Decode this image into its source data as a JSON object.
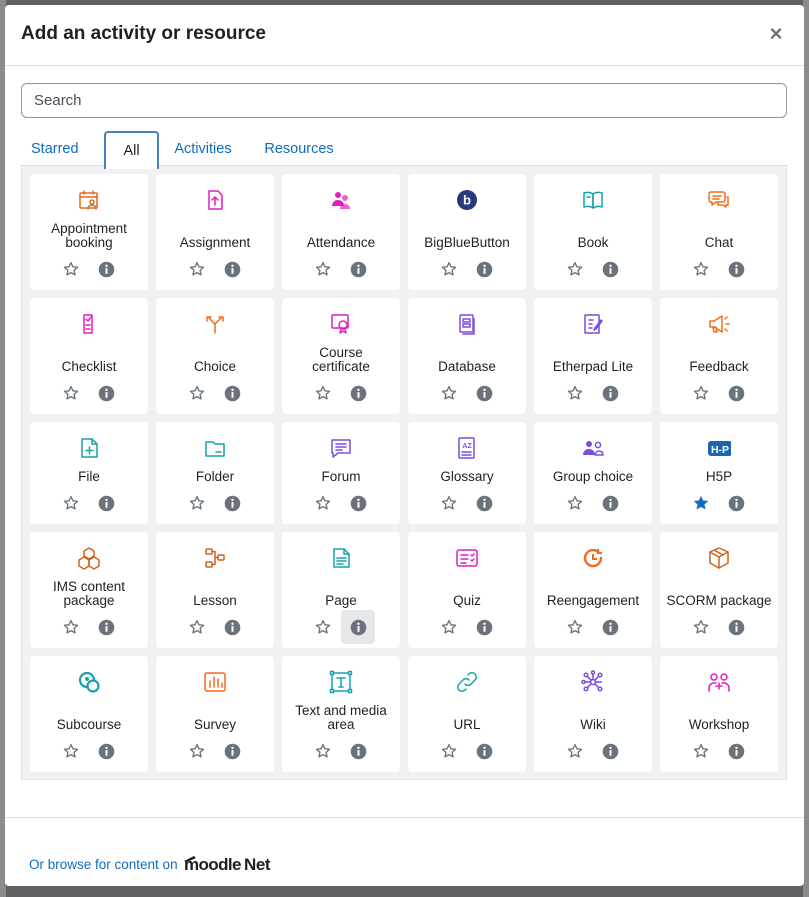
{
  "modal": {
    "title": "Add an activity or resource",
    "close_label": "×"
  },
  "search": {
    "placeholder": "Search",
    "value": ""
  },
  "tabs": [
    {
      "label": "Starred",
      "active": false
    },
    {
      "label": "All",
      "active": true
    },
    {
      "label": "Activities",
      "active": false
    },
    {
      "label": "Resources",
      "active": false
    }
  ],
  "items": [
    {
      "name": "Appointment booking",
      "lines": [
        "Appointment",
        "booking"
      ],
      "icon": "appointment-calendar-icon",
      "color": "#e06c1a",
      "starred": false
    },
    {
      "name": "Assignment",
      "lines": [
        "Assignment"
      ],
      "icon": "assignment-upload-icon",
      "color": "#e31ec0",
      "starred": false
    },
    {
      "name": "Attendance",
      "lines": [
        "Attendance"
      ],
      "icon": "attendance-people-icon",
      "color": "#e31ec0",
      "starred": false
    },
    {
      "name": "BigBlueButton",
      "lines": [
        "BigBlueButton"
      ],
      "icon": "bigbluebutton-icon",
      "color": "#273a7c",
      "starred": false
    },
    {
      "name": "Book",
      "lines": [
        "Book"
      ],
      "icon": "book-icon",
      "color": "#14a3a9",
      "starred": false
    },
    {
      "name": "Chat",
      "lines": [
        "Chat"
      ],
      "icon": "chat-icon",
      "color": "#f26b1d",
      "starred": false
    },
    {
      "name": "Checklist",
      "lines": [
        "Checklist"
      ],
      "icon": "checklist-icon",
      "color": "#e31ec0",
      "starred": false
    },
    {
      "name": "Choice",
      "lines": [
        "Choice"
      ],
      "icon": "choice-arrows-icon",
      "color": "#f26b1d",
      "starred": false
    },
    {
      "name": "Course certificate",
      "lines": [
        "Course",
        "certificate"
      ],
      "icon": "certificate-icon",
      "color": "#e31ec0",
      "starred": false
    },
    {
      "name": "Database",
      "lines": [
        "Database"
      ],
      "icon": "database-icon",
      "color": "#7a4fe0",
      "starred": false
    },
    {
      "name": "Etherpad Lite",
      "lines": [
        "Etherpad Lite"
      ],
      "icon": "etherpad-icon",
      "color": "#7a4fe0",
      "starred": false
    },
    {
      "name": "Feedback",
      "lines": [
        "Feedback"
      ],
      "icon": "feedback-megaphone-icon",
      "color": "#f26b1d",
      "starred": false
    },
    {
      "name": "File",
      "lines": [
        "File"
      ],
      "icon": "file-icon",
      "color": "#14a3a9",
      "starred": false
    },
    {
      "name": "Folder",
      "lines": [
        "Folder"
      ],
      "icon": "folder-icon",
      "color": "#14a3a9",
      "starred": false
    },
    {
      "name": "Forum",
      "lines": [
        "Forum"
      ],
      "icon": "forum-icon",
      "color": "#7a4fe0",
      "starred": false
    },
    {
      "name": "Glossary",
      "lines": [
        "Glossary"
      ],
      "icon": "glossary-icon",
      "color": "#7a4fe0",
      "starred": false
    },
    {
      "name": "Group choice",
      "lines": [
        "Group choice"
      ],
      "icon": "group-choice-icon",
      "color": "#7a4fe0",
      "starred": false
    },
    {
      "name": "H5P",
      "lines": [
        "H5P"
      ],
      "icon": "h5p-icon",
      "color": "#1b65b4",
      "starred": true
    },
    {
      "name": "IMS content package",
      "lines": [
        "IMS content",
        "package"
      ],
      "icon": "ims-package-icon",
      "color": "#d1621b",
      "starred": false
    },
    {
      "name": "Lesson",
      "lines": [
        "Lesson"
      ],
      "icon": "lesson-flow-icon",
      "color": "#d1621b",
      "starred": false
    },
    {
      "name": "Page",
      "lines": [
        "Page"
      ],
      "icon": "page-icon",
      "color": "#14a3a9",
      "starred": false
    },
    {
      "name": "Quiz",
      "lines": [
        "Quiz"
      ],
      "icon": "quiz-icon",
      "color": "#e31ec0",
      "starred": false
    },
    {
      "name": "Reengagement",
      "lines": [
        "Reengagement"
      ],
      "icon": "reengagement-icon",
      "color": "#f26b1d",
      "starred": false
    },
    {
      "name": "SCORM package",
      "lines": [
        "SCORM package"
      ],
      "icon": "scorm-box-icon",
      "color": "#d1621b",
      "starred": false
    },
    {
      "name": "Subcourse",
      "lines": [
        "Subcourse"
      ],
      "icon": "subcourse-icon",
      "color": "#14a3a9",
      "starred": false
    },
    {
      "name": "Survey",
      "lines": [
        "Survey"
      ],
      "icon": "survey-chart-icon",
      "color": "#f26b1d",
      "starred": false
    },
    {
      "name": "Text and media area",
      "lines": [
        "Text and media",
        "area"
      ],
      "icon": "text-media-icon",
      "color": "#14a3a9",
      "starred": false
    },
    {
      "name": "URL",
      "lines": [
        "URL"
      ],
      "icon": "url-link-icon",
      "color": "#14a3a9",
      "starred": false
    },
    {
      "name": "Wiki",
      "lines": [
        "Wiki"
      ],
      "icon": "wiki-network-icon",
      "color": "#7a4fe0",
      "starred": false
    },
    {
      "name": "Workshop",
      "lines": [
        "Workshop"
      ],
      "icon": "workshop-icon",
      "color": "#e31ec0",
      "starred": false
    }
  ],
  "footer": {
    "browse_text": "Or browse for content on",
    "logo_text": "moodleNet"
  },
  "colors": {
    "link": "#0f6cbf",
    "star_filled": "#0f6cbf",
    "icon_grey": "#6a737b"
  }
}
